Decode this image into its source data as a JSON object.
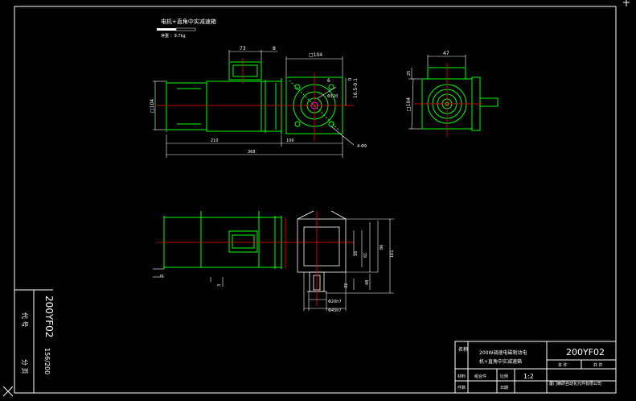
{
  "drawing": {
    "header": {
      "title": "电机+直角中实减速箱",
      "weight": "净重 ：9.7kg"
    },
    "front_view": {
      "dim_73": "73",
      "dim_8": "8",
      "dim_square_104_top": "□104",
      "dim_square_104_left": "□104",
      "dim_0": "0",
      "dim_16_5": "16.5-0.1",
      "dim_6": "6",
      "dim_phi120": "Φ120",
      "dim_4_phi9": "4-Φ9",
      "dim_210": "210",
      "dim_106": "106",
      "dim_368": "368"
    },
    "side_view": {
      "dim_47": "47",
      "dim_25": "25",
      "dim_square_104": "□104"
    },
    "bottom_view": {
      "dim_3": "3",
      "dim_3b": "3",
      "dim_16": "16",
      "dim_61": "61",
      "dim_86": "86",
      "dim_161": "161",
      "dim_32": "32",
      "dim_48": "48",
      "dim_phi20": "Φ20h7",
      "dim_phi45": "Φ45h7"
    },
    "side_label_block": {
      "code_rotated": "200YF02",
      "code_label": "代 号",
      "page_rotated": "156/200",
      "page_label": "分 页"
    },
    "title_block": {
      "name_label": "名称",
      "name_value_line1": "200W调速电磁制动电",
      "name_value_line2": "机+直角中实减速箱",
      "drawing_no": "200YF02",
      "material_label": "材料",
      "assembly_label": "组合件",
      "ratio_label": "比例",
      "ratio_value": "1:2",
      "this_label": "本 件",
      "total_label": "共 件",
      "pieces_label": "件数",
      "date_label": "日期",
      "company": "厦门精研自动化元件有限公司"
    }
  },
  "colors": {
    "background": "#000000",
    "part": "#00ff00",
    "centerline": "#ff0000",
    "dimension": "#ffffff",
    "frame": "#ffffff",
    "accent": "#ff00ff"
  }
}
